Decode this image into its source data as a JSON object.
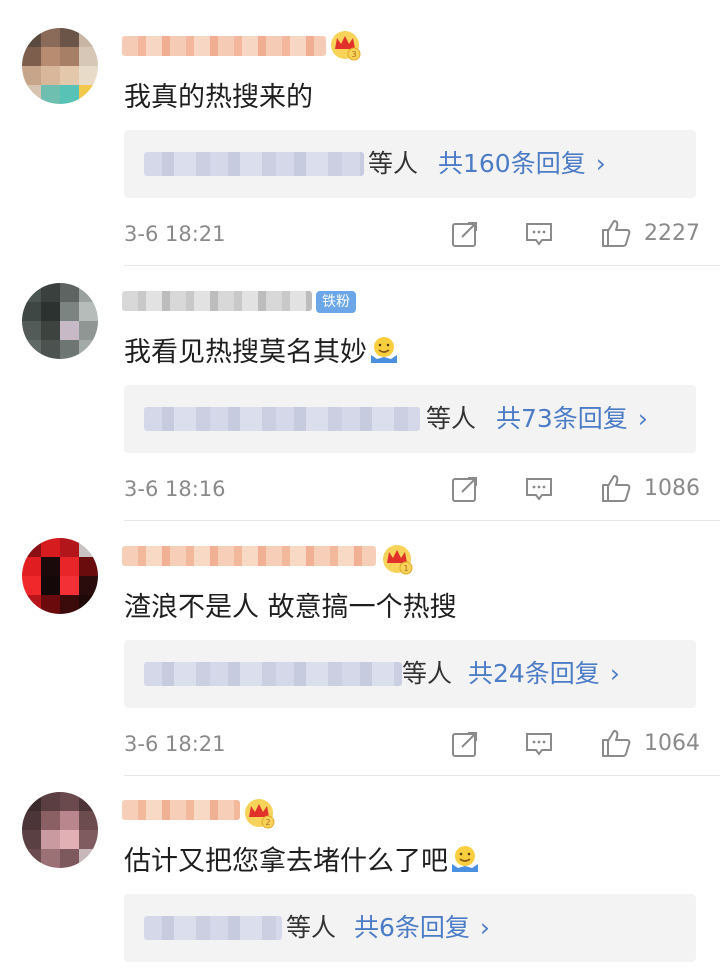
{
  "comments": [
    {
      "text": "我真的热搜来的",
      "reply_who": "等人",
      "reply_count": "共160条回复",
      "chevron": "›",
      "time": "3-6 18:21",
      "likes": "2227",
      "badge": "crown-badge-3"
    },
    {
      "text": "我看见热搜莫名其妙",
      "reply_who": "等人",
      "reply_count": "共73条回复",
      "chevron": "›",
      "time": "3-6 18:16",
      "likes": "1086",
      "badge_label": "铁粉"
    },
    {
      "text": "渣浪不是人 故意搞一个热搜",
      "reply_who": "等人",
      "reply_count": "共24条回复",
      "chevron": "›",
      "time": "3-6 18:21",
      "likes": "1064",
      "badge": "crown-badge-1"
    },
    {
      "text": "估计又把您拿去堵什么了吧",
      "reply_who": "等人",
      "reply_count": "共6条回复",
      "chevron": "›",
      "badge": "crown-badge-2"
    }
  ],
  "colors": {
    "link": "#4d7cc6",
    "meta": "#8a8a8a",
    "reply_bg": "#f3f3f3",
    "badge_blue": "#6ba7e8"
  },
  "icons": [
    "repost-icon",
    "comment-icon",
    "like-icon",
    "shrug-emoji-icon"
  ]
}
